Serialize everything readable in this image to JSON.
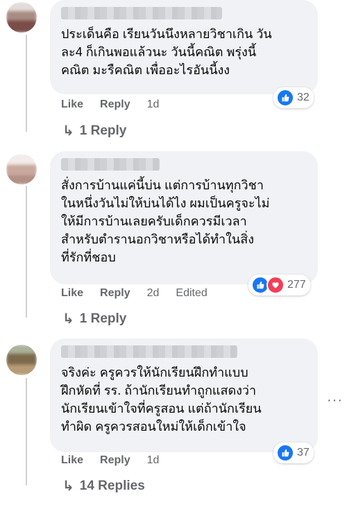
{
  "comments": [
    {
      "text": "ประเด็นคือ เรียนวันนึงหลายวิชาเกิน วัน\nละ4 ก็เกินพอแล้วนะ วันนี้คณิต พรุ่งนี้\nคณิต มะรืคณิต เพื่ออะไรอันนี้งง",
      "like_label": "Like",
      "reply_label": "Reply",
      "time": "1d",
      "edited": "",
      "reaction_count": "32",
      "reactions": [
        "like"
      ],
      "replies_label": "1 Reply"
    },
    {
      "text": "สั่งการบ้านแค่นี้บ่น แต่การบ้านทุกวิชา\nในหนึ่งวันไม่ให้บ่นได้ไง ผมเป็นครูจะไม่\nให้มีการบ้านเลยครับเด็กควรมีเวลา\nสำหรับตำรานอกวิชาหรือได้ทำในสิ่ง\nที่รักที่ชอบ",
      "like_label": "Like",
      "reply_label": "Reply",
      "time": "2d",
      "edited": "Edited",
      "reaction_count": "277",
      "reactions": [
        "like",
        "love"
      ],
      "replies_label": "1 Reply"
    },
    {
      "text": "จริงค่ะ ครูควรให้นักเรียนฝึกทำแบบ\nฝึกหัดที่ รร. ถ้านักเรียนทำถูกแสดงว่า\nนักเรียนเข้าใจที่ครูสอน แต่ถ้านักเรียน\nทำผิด ครูควรสอนใหม่ให้เด็กเข้าใจ",
      "like_label": "Like",
      "reply_label": "Reply",
      "time": "1d",
      "edited": "",
      "reaction_count": "37",
      "reactions": [
        "like"
      ],
      "replies_label": "14 Replies"
    }
  ],
  "icons": {
    "like": "thumbs-up-icon",
    "love": "heart-icon",
    "reply_arrow": "reply-arrow-icon",
    "more": "more-options-icon"
  },
  "more_label": "···",
  "colors": {
    "bubble": "#f0f2f5",
    "meta_text": "#65676b",
    "like_blue": "#1877f2",
    "love_red": "#f33e58"
  }
}
